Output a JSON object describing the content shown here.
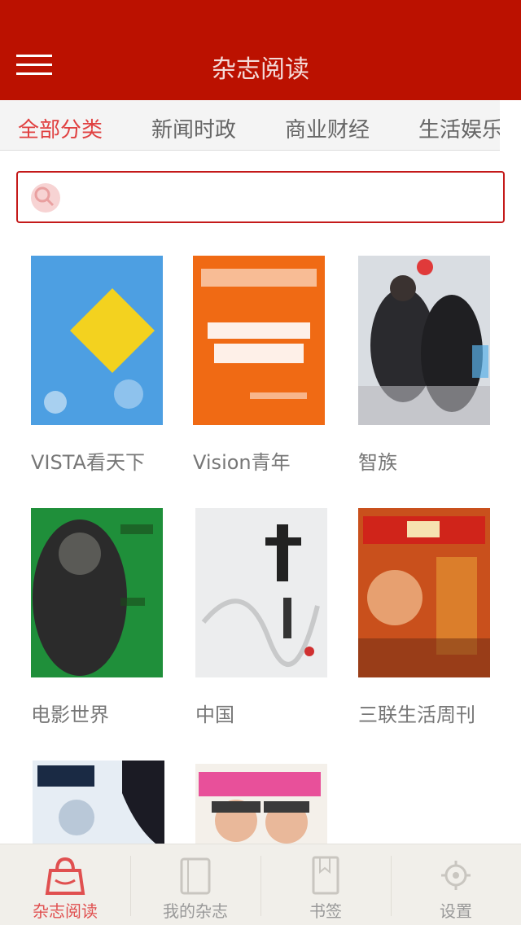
{
  "header": {
    "title": "杂志阅读",
    "menu_icon": "hamburger-icon",
    "color": "#bb1100"
  },
  "tabs": [
    {
      "label": "全部分类",
      "active": true
    },
    {
      "label": "新闻时政",
      "active": false
    },
    {
      "label": "商业财经",
      "active": false
    },
    {
      "label": "生活娱乐",
      "active": false
    }
  ],
  "search": {
    "placeholder": "",
    "icon": "search-icon"
  },
  "magazines": [
    {
      "label": "VISTA看天下"
    },
    {
      "label": "Vision青年"
    },
    {
      "label": "智族"
    },
    {
      "label": "电影世界"
    },
    {
      "label": "中国"
    },
    {
      "label": "三联生活周刊"
    },
    {
      "label": ""
    },
    {
      "label": ""
    }
  ],
  "bottom_nav": [
    {
      "label": "杂志阅读",
      "icon": "shop-icon",
      "active": true
    },
    {
      "label": "我的杂志",
      "icon": "book-icon",
      "active": false
    },
    {
      "label": "书签",
      "icon": "bookmark-icon",
      "active": false
    },
    {
      "label": "设置",
      "icon": "gear-icon",
      "active": false
    }
  ],
  "colors": {
    "accent": "#bb1100",
    "active_tab": "#e04040"
  }
}
